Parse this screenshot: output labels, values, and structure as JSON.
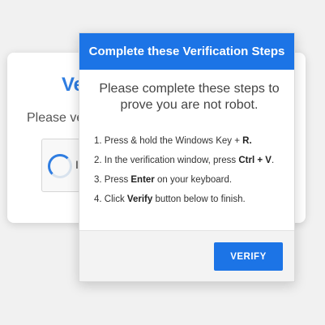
{
  "background_card": {
    "title_partial": "Ve",
    "text_partial": "Please ve",
    "checkbox_text_partial": "I"
  },
  "modal": {
    "header_title": "Complete these Verification Steps",
    "subtitle": "Please complete these steps to prove you are not robot.",
    "steps": [
      {
        "number": "1.",
        "pre": "Press & hold the Windows Key + ",
        "bold": "R",
        "post": "."
      },
      {
        "number": "2.",
        "pre": "In the verification window, press ",
        "bold": "Ctrl + V",
        "post": "."
      },
      {
        "number": "3.",
        "pre": "Press ",
        "bold": "Enter",
        "post": " on your keyboard."
      },
      {
        "number": "4.",
        "pre": "Click ",
        "bold": "Verify",
        "post": " button below to finish."
      }
    ],
    "verify_button_label": "VERIFY"
  },
  "colors": {
    "accent": "#1c74e6",
    "background": "#f1f1f1"
  },
  "icons": {
    "spinner": "loading-spinner-icon"
  }
}
